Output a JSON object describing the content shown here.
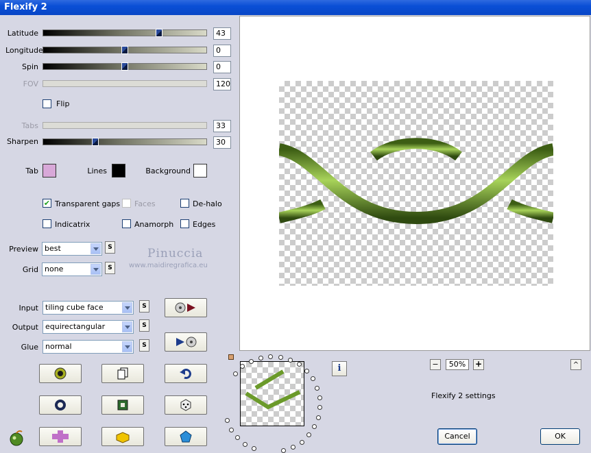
{
  "window": {
    "title": "Flexify 2"
  },
  "sliders": {
    "latitude": {
      "label": "Latitude",
      "value": "43",
      "fraction": 0.72
    },
    "longitude": {
      "label": "Longitude",
      "value": "0",
      "fraction": 0.5
    },
    "spin": {
      "label": "Spin",
      "value": "0",
      "fraction": 0.5
    },
    "fov": {
      "label": "FOV",
      "value": "120"
    },
    "tabs": {
      "label": "Tabs",
      "value": "33"
    },
    "sharpen": {
      "label": "Sharpen",
      "value": "30",
      "fraction": 0.31
    }
  },
  "flip": {
    "label": "Flip",
    "checked": false
  },
  "colors": {
    "tab": {
      "label": "Tab",
      "color": "#d8a8d8"
    },
    "lines": {
      "label": "Lines",
      "color": "#000000"
    },
    "background": {
      "label": "Background",
      "color": "#ffffff"
    }
  },
  "options": {
    "transparent_gaps": {
      "label": "Transparent gaps",
      "checked": true
    },
    "faces": {
      "label": "Faces",
      "checked": false
    },
    "de_halo": {
      "label": "De-halo",
      "checked": false
    },
    "indicatrix": {
      "label": "Indicatrix",
      "checked": false
    },
    "anamorph": {
      "label": "Anamorph",
      "checked": false
    },
    "edges": {
      "label": "Edges",
      "checked": false
    }
  },
  "preview_select": {
    "label": "Preview",
    "value": "best"
  },
  "grid_select": {
    "label": "Grid",
    "value": "none"
  },
  "input_select": {
    "label": "Input",
    "value": "tiling cube face"
  },
  "output_select": {
    "label": "Output",
    "value": "equirectangular"
  },
  "glue_select": {
    "label": "Glue",
    "value": "normal"
  },
  "s_button_label": "S",
  "watermark": {
    "name": "Pinuccia",
    "url": "www.maidiregrafica.eu"
  },
  "zoom": {
    "minus": "−",
    "value": "50%",
    "plus": "+"
  },
  "settings_label": "Flexify 2 settings",
  "info_label": "i",
  "scroll_up": "^",
  "buttons": {
    "cancel": "Cancel",
    "ok": "OK"
  },
  "accent_green": "#6b9a2a"
}
